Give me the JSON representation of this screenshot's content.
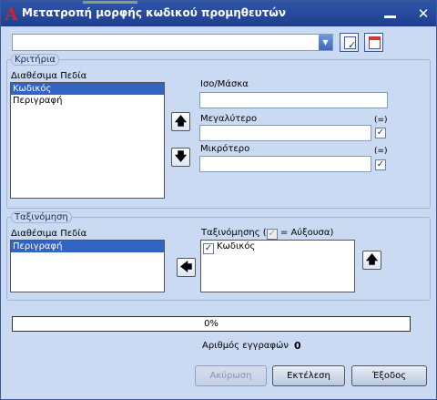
{
  "window": {
    "title": "Μετατροπή μορφής κωδικού προμηθευτών",
    "app_icon_glyph": "A",
    "minimize_glyph": "",
    "close_glyph": "✕"
  },
  "combo": {
    "value": "",
    "arrow_glyph": "▼"
  },
  "icons": {
    "apply_check": "✓"
  },
  "criteria": {
    "legend": "Κριτήρια",
    "available_label": "Διαθέσιμα Πεδία",
    "items": [
      {
        "label": "Κωδικός",
        "selected": true
      },
      {
        "label": "Περιγραφή",
        "selected": false
      }
    ],
    "up_glyph": "🡅",
    "down_glyph": "🡇",
    "iso_label": "Ισο/Μάσκα",
    "iso_value": "",
    "greater_label": "Μεγαλύτερο",
    "greater_value": "",
    "greater_eq_label": "(=)",
    "greater_eq_checked": true,
    "less_label": "Μικρότερο",
    "less_value": "",
    "less_eq_label": "(=)",
    "less_eq_checked": true,
    "check_glyph": "✓"
  },
  "sorting": {
    "legend": "Ταξινόμηση",
    "available_label": "Διαθέσιμα Πεδία",
    "available_items": [
      {
        "label": "Περιγραφή",
        "selected": true
      }
    ],
    "sort_label_prefix": "Ταξινόμησης (",
    "sort_label_suffix": " = Αύξουσα)",
    "legend_check_glyph": "✓",
    "sort_items": [
      {
        "label": "Κωδικός",
        "checked": true
      }
    ],
    "move_left_glyph": "🡄",
    "up_glyph": "🡅",
    "check_glyph": "✓"
  },
  "progress": {
    "percent_text": "0%",
    "value": 0
  },
  "records": {
    "label": "Αριθμός εγγραφών",
    "count": "0"
  },
  "buttons": {
    "cancel": "Ακύρωση",
    "execute": "Εκτέλεση",
    "exit": "Έξοδος"
  }
}
